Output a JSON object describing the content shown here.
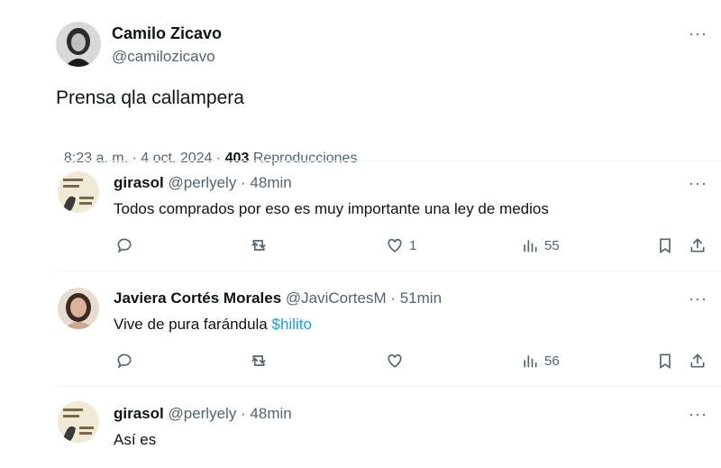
{
  "main_post": {
    "display_name": "Camilo Zicavo",
    "handle": "@camilozicavo",
    "text": "Prensa qla callampera",
    "time": "8:23 a. m. · 4 oct. 2024 · ",
    "views_count": "403",
    "views_label": "Reproducciones",
    "more_label": "···"
  },
  "replies": [
    {
      "display_name": "girasol",
      "meta": "@perlyely · 48min",
      "text": "Todos comprados por eso es muy importante una ley de medios",
      "likes": "1",
      "views": "55",
      "more_label": "···"
    },
    {
      "display_name": "Javiera Cortés Morales",
      "meta": "@JaviCortesM · 51min",
      "text": "Vive de pura farándula ",
      "cashtag": "$hilito",
      "likes": "",
      "views": "56",
      "more_label": "···"
    },
    {
      "display_name": "girasol",
      "meta": "@perlyely · 48min",
      "text": "Así es",
      "more_label": "···"
    }
  ],
  "icons": [
    "reply-icon",
    "retweet-icon",
    "like-icon",
    "views-icon",
    "bookmark-icon",
    "share-icon",
    "more-icon"
  ],
  "colors": {
    "text": "#0f1419",
    "muted": "#536471",
    "link": "#1d9bf0",
    "divider": "#eff3f4"
  }
}
